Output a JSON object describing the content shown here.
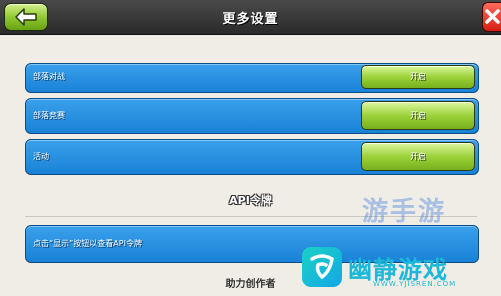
{
  "header": {
    "title": "更多设置",
    "back_icon": "back-arrow-icon",
    "close_icon": "close-icon"
  },
  "settings_rows": [
    {
      "label": "部落对战",
      "button_label": "开启"
    },
    {
      "label": "部落竞赛",
      "button_label": "开启"
    },
    {
      "label": "活动",
      "button_label": "开启"
    }
  ],
  "api_section": {
    "title": "API令牌",
    "row_label": "点击“显示”按钮以查看API令牌"
  },
  "creator_section": {
    "title": "助力创作者"
  },
  "watermark": {
    "overlay_text": "游手游",
    "brand": "幽静游戏",
    "url": "WWW.YJISREN.COM"
  },
  "colors": {
    "row_blue": "#1a82d6",
    "button_green": "#8cc52a",
    "close_red": "#d41f14"
  }
}
